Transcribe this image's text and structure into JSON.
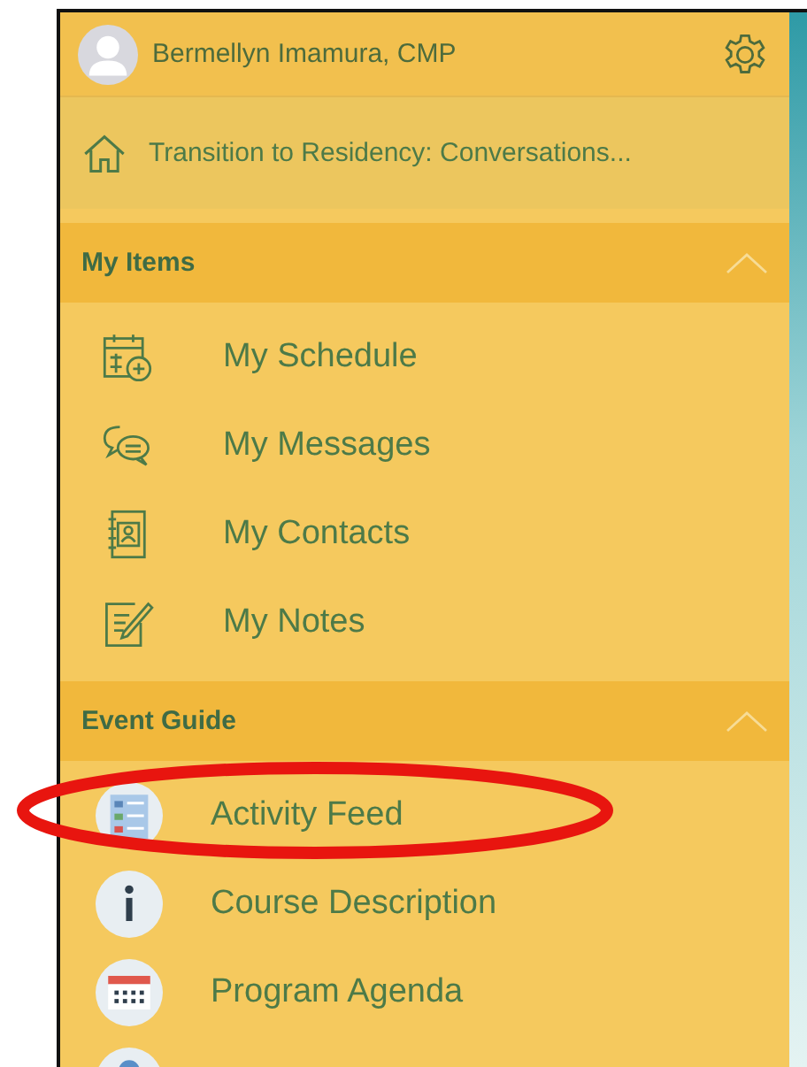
{
  "user": {
    "name": "Bermellyn Imamura, CMP"
  },
  "event": {
    "title": "Transition to Residency: Conversations..."
  },
  "sections": [
    {
      "title": "My Items",
      "expanded": true,
      "items": [
        {
          "label": "My Schedule"
        },
        {
          "label": "My Messages"
        },
        {
          "label": "My Contacts"
        },
        {
          "label": "My Notes"
        }
      ]
    },
    {
      "title": "Event Guide",
      "expanded": true,
      "items": [
        {
          "label": "Activity Feed"
        },
        {
          "label": "Course Description"
        },
        {
          "label": "Program Agenda"
        }
      ]
    }
  ]
}
